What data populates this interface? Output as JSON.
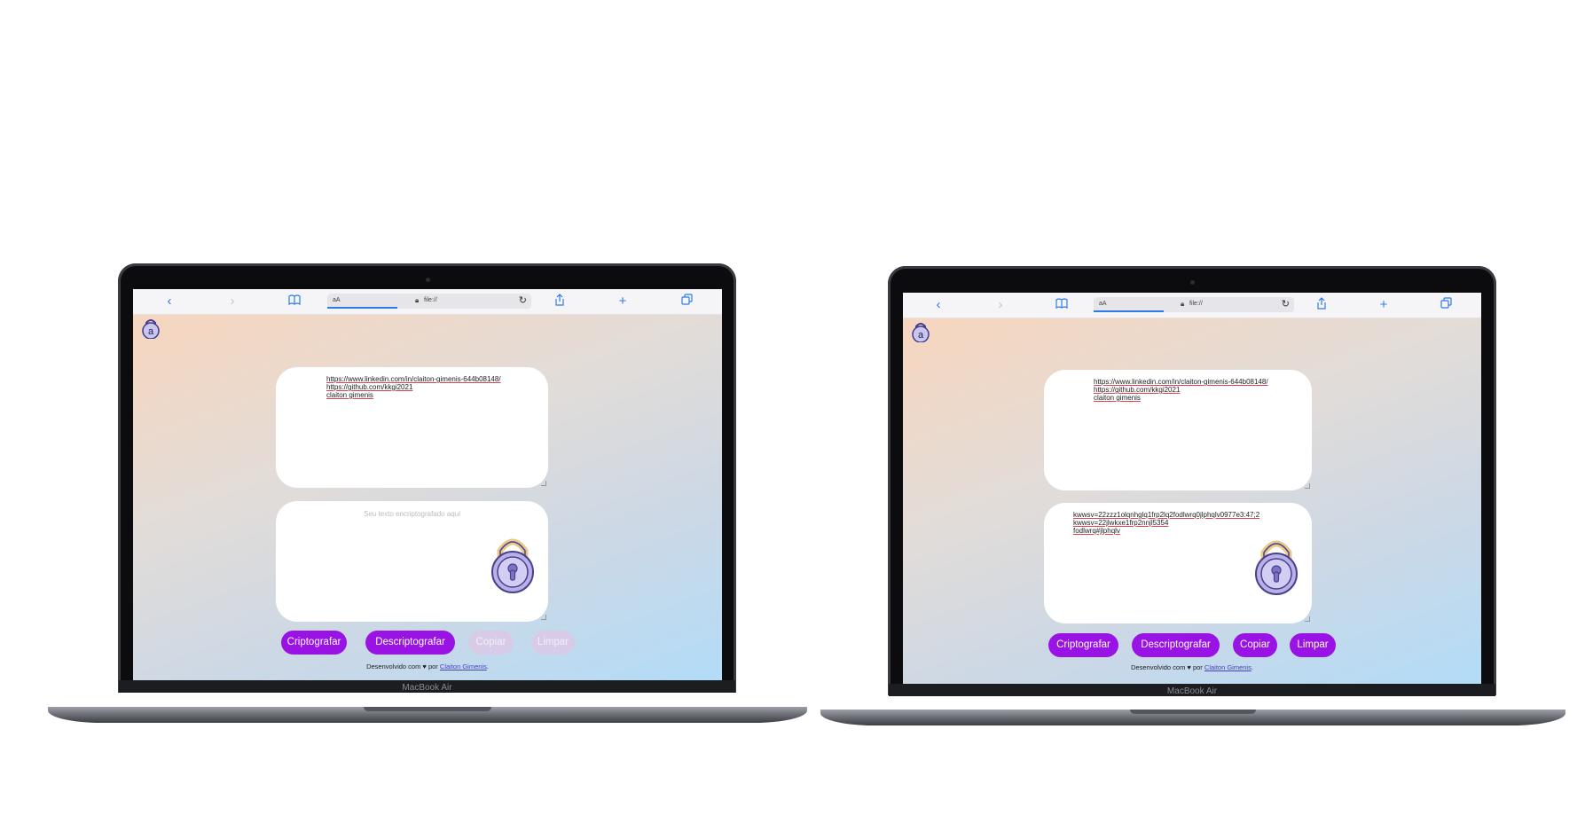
{
  "laptops": [
    {
      "model_label": "MacBook Air",
      "browser": {
        "aa_label": "aA",
        "url": "file://",
        "back_icon": "chevron-left-icon",
        "forward_icon": "chevron-right-icon",
        "bookmarks_icon": "book-icon",
        "share_icon": "share-icon",
        "new_tab_icon": "plus-icon",
        "tabs_icon": "tabs-icon"
      },
      "app": {
        "logo_icon": "padlock-a-logo-icon",
        "input_text": "https://www.linkedin.com/in/claiton-gimenis-644b08148/\nhttps://github.com/kkgi2021\nclaiton gimenis",
        "output_placeholder": "Seu texto encriptografado aqui",
        "output_text": "",
        "output_icon": "padlock-icon",
        "buttons": [
          {
            "label": "Criptografar",
            "state": "active"
          },
          {
            "label": "Descriptografar",
            "state": "active"
          },
          {
            "label": "Copiar",
            "state": "disabled"
          },
          {
            "label": "Limpar",
            "state": "disabled"
          }
        ],
        "footer_prefix": "Desenvolvido com ♥ por",
        "footer_author": "Claiton Gimenis",
        "footer_suffix": "."
      }
    },
    {
      "model_label": "MacBook Air",
      "browser": {
        "aa_label": "aA",
        "url": "file://",
        "back_icon": "chevron-left-icon",
        "forward_icon": "chevron-right-icon",
        "bookmarks_icon": "book-icon",
        "share_icon": "share-icon",
        "new_tab_icon": "plus-icon",
        "tabs_icon": "tabs-icon"
      },
      "app": {
        "logo_icon": "padlock-a-logo-icon",
        "input_text": "https://www.linkedin.com/in/claiton-gimenis-644b08148/\nhttps://github.com/kkgi2021\nclaiton gimenis",
        "output_placeholder": "",
        "output_text": "kwwsv=22zzz1olqnhglq1frp2lq2fodlwrq0jlphqlv0977e3:47;2\nkwwsv=22jlwkxe1frp2nnjl5354\nfodlwrq#jlphqlv",
        "output_icon": "padlock-icon",
        "buttons": [
          {
            "label": "Criptografar",
            "state": "active"
          },
          {
            "label": "Descriptografar",
            "state": "active"
          },
          {
            "label": "Copiar",
            "state": "active"
          },
          {
            "label": "Limpar",
            "state": "active"
          }
        ],
        "footer_prefix": "Desenvolvido com ♥ por",
        "footer_author": "Claiton Gimenis",
        "footer_suffix": "."
      }
    }
  ]
}
